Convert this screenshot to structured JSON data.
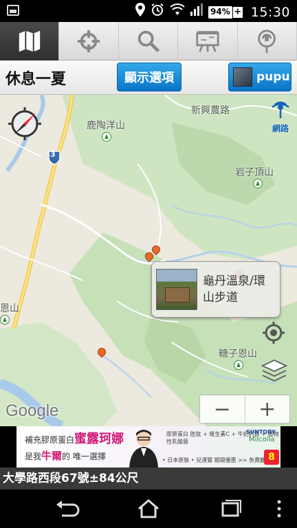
{
  "status_bar": {
    "battery": "94%",
    "time": "15:30",
    "icons": [
      "image-icon",
      "location-icon",
      "alarm-icon",
      "wifi-icon",
      "signal-icon",
      "battery-icon"
    ]
  },
  "tabs": [
    {
      "name": "map",
      "icon": "map-icon",
      "active": true
    },
    {
      "name": "crosshair",
      "icon": "crosshair-icon",
      "active": false
    },
    {
      "name": "search",
      "icon": "search-icon",
      "active": false
    },
    {
      "name": "board",
      "icon": "signboard-icon",
      "active": false
    },
    {
      "name": "pin",
      "icon": "pin-icon",
      "active": false
    }
  ],
  "header": {
    "title": "休息一夏",
    "options_label": "顯示選項",
    "user_label": "pupu"
  },
  "map": {
    "network_label": "網路",
    "places": [
      {
        "id": "xinxing_road",
        "label": "新興農路"
      },
      {
        "id": "lutaoyang_mt",
        "label": "鹿陶洋山"
      },
      {
        "id": "yanzi_peak",
        "label": "岩子頂山"
      },
      {
        "id": "tangzi_mt",
        "label": "糖子恩山"
      },
      {
        "id": "left_edge",
        "label": "恩山"
      }
    ],
    "route_number": "3",
    "popup": {
      "line1": "龜丹溫泉/環",
      "line2": "山步道"
    },
    "zoom_out": "−",
    "zoom_in": "+",
    "attribution": "Google"
  },
  "ad": {
    "line1_prefix": "補充膠原蛋白",
    "line1_highlight": "蜜露珂娜",
    "line2_prefix": "是我",
    "line2_highlight": "牛爾",
    "line2_suffix": "的 唯一選擇",
    "products": "膠原蛋白 胜肽 + 維生素C + 牛奶鈣質 + 植物性乳酸菌",
    "brand": "SUNTORY",
    "brand2": "Milcolla",
    "footer": "• 日本原裝 • 兒運實 期間優惠 >> 免費體驗8",
    "badge": "8"
  },
  "address": "大學路西段67號±84公尺",
  "nav": [
    "back-icon",
    "home-icon",
    "recent-apps-icon",
    "menu-icon"
  ]
}
